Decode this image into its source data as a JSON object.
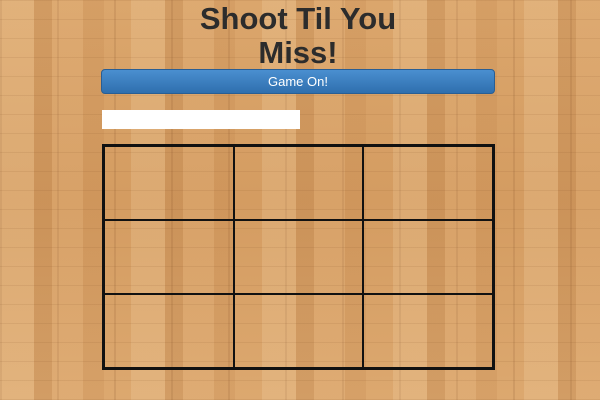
{
  "title": {
    "line1": "Shoot Til You",
    "line2": "Miss!"
  },
  "start_button": {
    "label": "Game On!"
  },
  "name_input": {
    "value": "",
    "placeholder": ""
  },
  "board": {
    "rows": 3,
    "columns": 3,
    "cells": [
      "",
      "",
      "",
      "",
      "",
      "",
      "",
      "",
      ""
    ]
  },
  "colors": {
    "button": "#2f6fae",
    "grid_lines": "#111111",
    "title_text": "#2c2c2c",
    "floor": "#d9a56d"
  }
}
